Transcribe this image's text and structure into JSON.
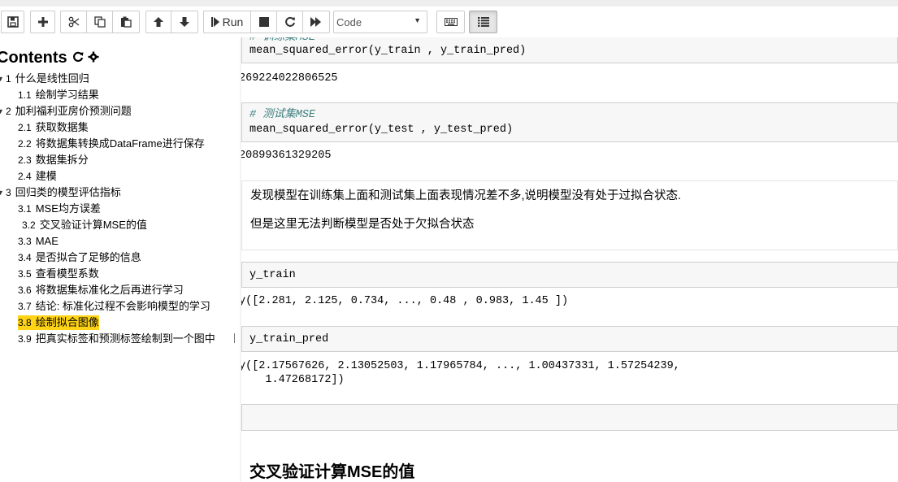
{
  "toolbar": {
    "run_label": "Run",
    "cell_type": "Code",
    "buttons": [
      "save-icon",
      "plus-icon",
      "cut-icon",
      "copy-icon",
      "paste-icon",
      "move-up-icon",
      "move-down-icon",
      "run-icon",
      "stop-icon",
      "restart-icon",
      "fast-forward-icon",
      "keyboard-icon",
      "toc-list-icon"
    ]
  },
  "toc": {
    "title": "Contents",
    "items": [
      {
        "num": "1",
        "label": "什么是线性回归",
        "collapsible": true
      },
      {
        "num": "1.1",
        "label": "绘制学习结果"
      },
      {
        "num": "2",
        "label": "加利福利亚房价预测问题",
        "collapsible": true
      },
      {
        "num": "2.1",
        "label": "获取数据集"
      },
      {
        "num": "2.2",
        "label": "将数据集转换成DataFrame进行保存"
      },
      {
        "num": "2.3",
        "label": "数据集拆分"
      },
      {
        "num": "2.4",
        "label": "建模"
      },
      {
        "num": "3",
        "label": "回归类的模型评估指标",
        "collapsible": true
      },
      {
        "num": "3.1",
        "label": "MSE均方误差"
      },
      {
        "num": "3.2",
        "label": "交叉验证计算MSE的值"
      },
      {
        "num": "3.3",
        "label": "MAE"
      },
      {
        "num": "3.4",
        "label": "是否拟合了足够的信息"
      },
      {
        "num": "3.5",
        "label": "查看模型系数"
      },
      {
        "num": "3.6",
        "label": "将数据集标准化之后再进行学习"
      },
      {
        "num": "3.7",
        "label": "结论: 标准化过程不会影响模型的学习"
      },
      {
        "num": "3.8",
        "label": "绘制拟合图像",
        "highlighted": true
      },
      {
        "num": "3.9",
        "label": "把真实标签和预测标签绘制到一个图中"
      }
    ]
  },
  "notebook": {
    "cell1_comment": "# 训练集MSE",
    "cell1_code": "mean_squared_error(y_train , y_train_pred)",
    "out1": "269224022806525",
    "cell2_comment": "# 测试集MSE",
    "cell2_code": "mean_squared_error(y_test , y_test_pred)",
    "out2": "20899361329205",
    "md_line1": "发现模型在训练集上面和测试集上面表现情况差不多,说明模型没有处于过拟合状态.",
    "md_line2": "但是这里无法判断模型是否处于欠拟合状态",
    "cell3_code": "y_train",
    "out3": "y([2.281, 2.125, 0.734, ..., 0.48 , 0.983, 1.45 ])",
    "cell4_code": "y_train_pred",
    "out4_line1": "y([2.17567626, 2.13052503, 1.17965784, ..., 1.00437331, 1.57254239,",
    "out4_line2": "    1.47268172])",
    "heading": "交叉验证计算MSE的值"
  }
}
